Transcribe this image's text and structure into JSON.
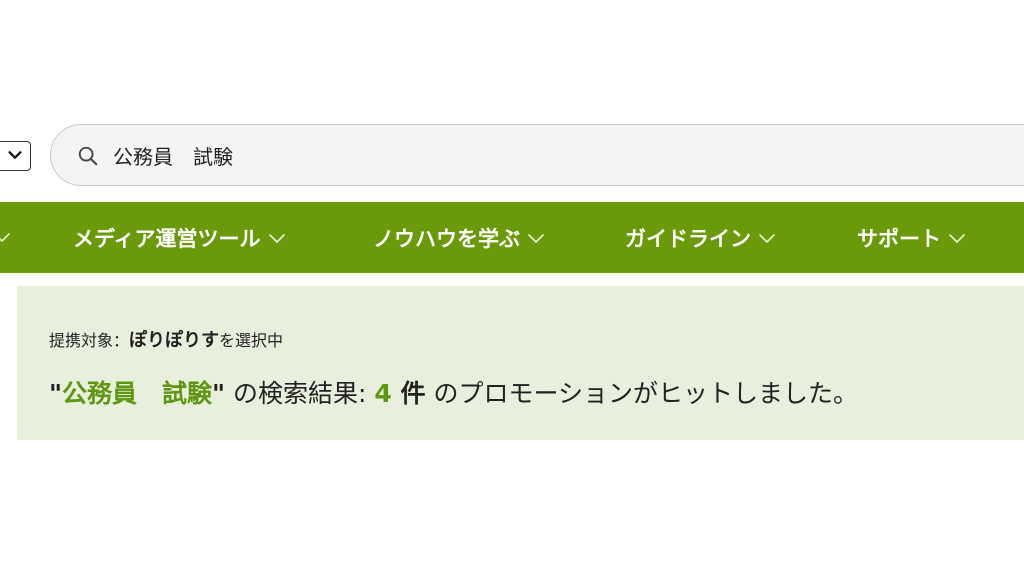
{
  "search": {
    "query": "公務員　試験"
  },
  "nav": {
    "items": [
      {
        "label": "メディア運営ツール"
      },
      {
        "label": "ノウハウを学ぶ"
      },
      {
        "label": "ガイドライン"
      },
      {
        "label": "サポート"
      }
    ]
  },
  "result": {
    "affiliation_prefix": "提携対象：",
    "affiliation_name": "ぽりぽりす",
    "affiliation_suffix": "を選択中",
    "open_quote": "\"",
    "keyword": "公務員　試験",
    "close_quote": "\"",
    "text_before_count": " の検索結果: ",
    "count": "4",
    "count_unit": " 件",
    "text_after_count": " のプロモーションがヒットしました。"
  },
  "colors": {
    "nav_bg": "#6a9a0a",
    "panel_bg": "#e8efdc",
    "accent_green": "#5f9612"
  },
  "icons": {
    "search": "search-icon",
    "dropdown": "chevron-down-icon"
  }
}
